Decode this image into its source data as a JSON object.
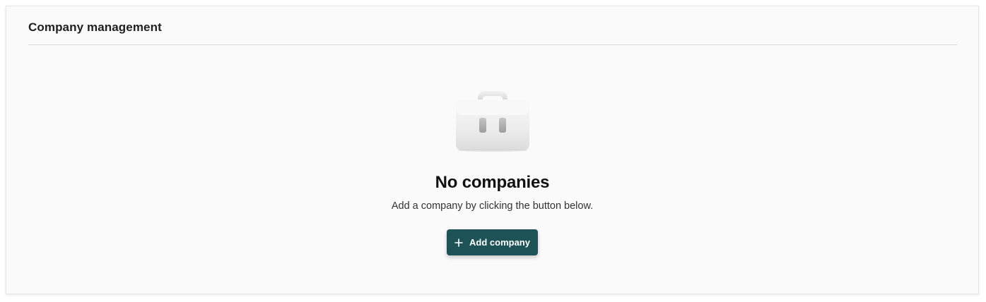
{
  "header": {
    "title": "Company management"
  },
  "empty_state": {
    "icon": "briefcase-icon",
    "title": "No companies",
    "description": "Add a company by clicking the button below.",
    "button_label": "Add company",
    "button_icon": "plus-icon"
  },
  "colors": {
    "primary_button": "#1d5356",
    "background": "#fafafa"
  }
}
